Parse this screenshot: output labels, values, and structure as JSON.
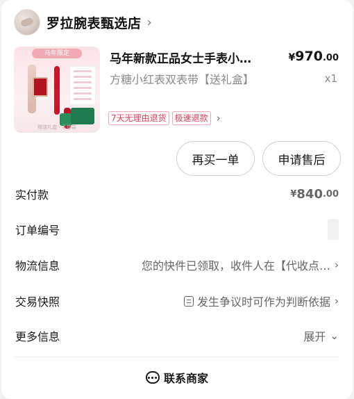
{
  "shop": {
    "name": "罗拉腕表甄选店",
    "chevron": "›"
  },
  "product": {
    "image_texts": {
      "banner": "马年限定",
      "bottom": "赠送礼盒 · 手提袋"
    },
    "title": "马年新款正品女士手表小…",
    "price": {
      "symbol": "¥",
      "integer": "970",
      "decimal": ".00"
    },
    "sku": "方糖小红表双表带【送礼盒】",
    "quantity": "x1",
    "tags": [
      "7天无理由退货",
      "极速退款"
    ],
    "tags_chevron": "›"
  },
  "actions": {
    "rebuy": "再买一单",
    "after_sale": "申请售后"
  },
  "info": {
    "paid": {
      "label": "实付款",
      "symbol": "¥",
      "integer": "840",
      "decimal": ".00"
    },
    "order_no": {
      "label": "订单编号"
    },
    "logistics": {
      "label": "物流信息",
      "value": "您的快件已领取，收件人在【代收点…",
      "chevron": "›"
    },
    "snapshot": {
      "label": "交易快照",
      "value": "发生争议时可作为判断依据",
      "chevron": "›"
    },
    "more": {
      "label": "更多信息",
      "value": "展开",
      "chevron": "⌄"
    }
  },
  "contact": {
    "label": "联系商家"
  },
  "colors": {
    "accent": "#e8305a",
    "tag_border": "#f2a7b5"
  }
}
